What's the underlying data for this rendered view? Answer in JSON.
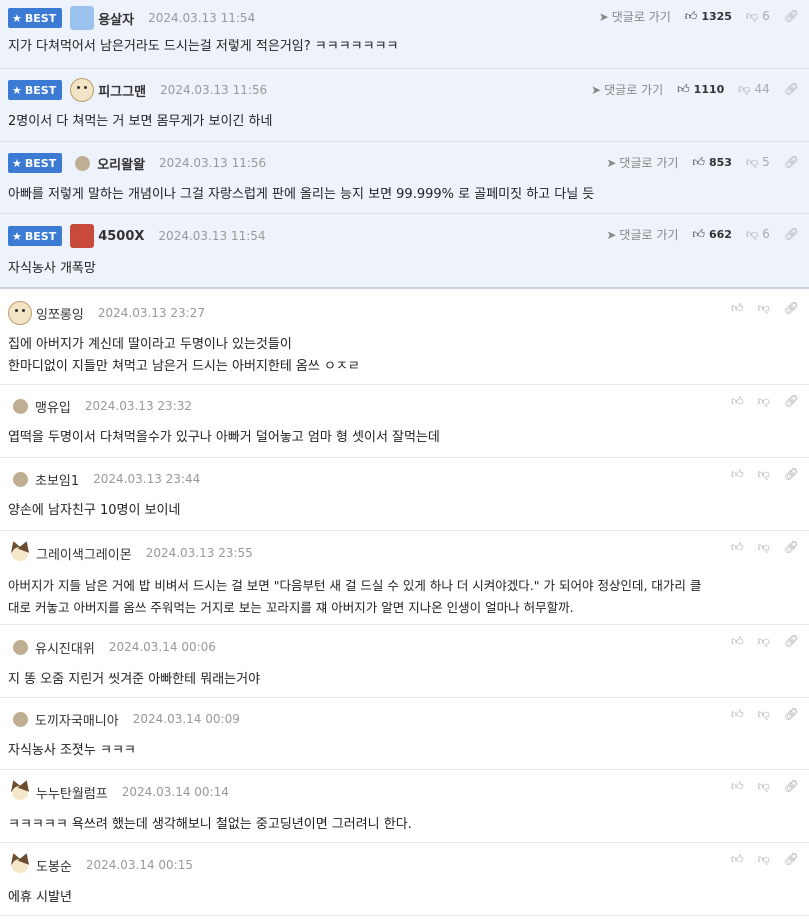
{
  "labels": {
    "best": "BEST",
    "reply": "댓글로 가기"
  },
  "best_comments": [
    {
      "nick": "용살자",
      "date": "2024.03.13 11:54",
      "up": "1325",
      "down": "6",
      "avatar": "blue-icon",
      "text": "지가 다쳐먹어서 남은거라도 드시는걸 저렇게 적은거임? ㅋㅋㅋㅋㅋㅋㅋ"
    },
    {
      "nick": "피그그맨",
      "date": "2024.03.13 11:56",
      "up": "1110",
      "down": "44",
      "avatar": "dog-icon",
      "text": "2명이서 다 쳐먹는 거 보면 몸무게가 보이긴 하네"
    },
    {
      "nick": "오리왈왈",
      "date": "2024.03.13 11:56",
      "up": "853",
      "down": "5",
      "avatar": "blob-icon",
      "text": "아빠를 저렇게 말하는 개념이나 그걸 자랑스럽게 판에 올리는 능지 보면 99.999% 로 골페미짓 하고 다닐 듯"
    },
    {
      "nick": "4500X",
      "date": "2024.03.13 11:54",
      "up": "662",
      "down": "6",
      "avatar": "red-icon",
      "text": "자식농사 개폭망"
    }
  ],
  "comments": [
    {
      "nick": "잉쪼롱잉",
      "date": "2024.03.13 23:27",
      "avatar": "dog-icon",
      "lines": [
        "집에 아버지가 계신데 딸이라고 두명이나 있는것들이",
        "한마디없이 지들만 쳐먹고 남은거 드시는 아버지한테 옴쓰 ㅇㅈㄹ"
      ]
    },
    {
      "nick": "맹유입",
      "date": "2024.03.13 23:32",
      "avatar": "blob-icon",
      "lines": [
        "엽떡을 두명이서 다쳐먹을수가 있구나 아빠거 덜어놓고 엄마 형 셋이서 잘먹는데"
      ]
    },
    {
      "nick": "초보임1",
      "date": "2024.03.13 23:44",
      "avatar": "blob-icon",
      "lines": [
        "양손에 남자친구 10명이 보이네"
      ]
    },
    {
      "nick": "그레이색그레이몬",
      "date": "2024.03.13 23:55",
      "avatar": "chihuahua-icon",
      "lines": [
        "아버지가 지들 남은 거에 밥 비벼서 드시는 걸 보면 \"다음부턴 새 걸 드실 수 있게 하나 더 시켜야겠다.\" 가 되어야 정상인데, 대가리 클",
        "대로 커놓고 아버지를 옴쓰 주워먹는 거지로 보는 꼬라지를 쟤 아버지가 알면 지나온 인생이 얼마나 허무할까."
      ]
    },
    {
      "nick": "유시진대위",
      "date": "2024.03.14 00:06",
      "avatar": "blob-icon",
      "lines": [
        "지 똥 오줌 지린거 씻겨준 아빠한테 뭐래는거야"
      ]
    },
    {
      "nick": "도끼자국매니아",
      "date": "2024.03.14 00:09",
      "avatar": "blob-icon",
      "lines": [
        "자식농사 조졋누 ㅋㅋㅋ"
      ]
    },
    {
      "nick": "누누탄월럼프",
      "date": "2024.03.14 00:14",
      "avatar": "chihuahua-icon",
      "lines": [
        "ㅋㅋㅋㅋㅋ 욕쓰려 했는데 생각해보니 철없는 중고딩년이면 그러려니 한다."
      ]
    },
    {
      "nick": "도봉순",
      "date": "2024.03.14 00:15",
      "avatar": "chihuahua-icon",
      "lines": [
        "에휴 시발년"
      ]
    }
  ]
}
